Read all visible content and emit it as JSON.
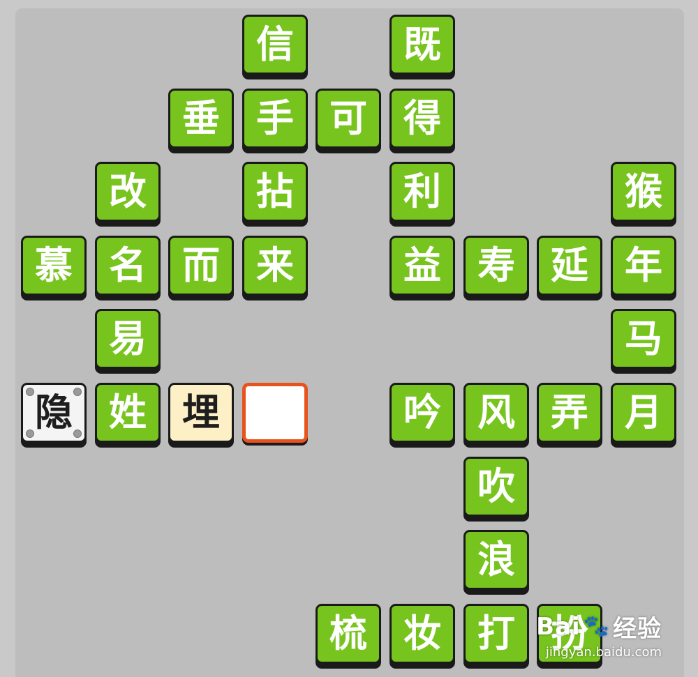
{
  "tiles": [
    {
      "ch": "信",
      "state": "green",
      "col": 3,
      "row": 0
    },
    {
      "ch": "既",
      "state": "green",
      "col": 5,
      "row": 0
    },
    {
      "ch": "垂",
      "state": "green",
      "col": 2,
      "row": 1
    },
    {
      "ch": "手",
      "state": "green",
      "col": 3,
      "row": 1
    },
    {
      "ch": "可",
      "state": "green",
      "col": 4,
      "row": 1
    },
    {
      "ch": "得",
      "state": "green",
      "col": 5,
      "row": 1
    },
    {
      "ch": "改",
      "state": "green",
      "col": 1,
      "row": 2
    },
    {
      "ch": "拈",
      "state": "green",
      "col": 3,
      "row": 2
    },
    {
      "ch": "利",
      "state": "green",
      "col": 5,
      "row": 2
    },
    {
      "ch": "猴",
      "state": "green",
      "col": 8,
      "row": 2
    },
    {
      "ch": "慕",
      "state": "green",
      "col": 0,
      "row": 3
    },
    {
      "ch": "名",
      "state": "green",
      "col": 1,
      "row": 3
    },
    {
      "ch": "而",
      "state": "green",
      "col": 2,
      "row": 3
    },
    {
      "ch": "来",
      "state": "green",
      "col": 3,
      "row": 3
    },
    {
      "ch": "益",
      "state": "green",
      "col": 5,
      "row": 3
    },
    {
      "ch": "寿",
      "state": "green",
      "col": 6,
      "row": 3
    },
    {
      "ch": "延",
      "state": "green",
      "col": 7,
      "row": 3
    },
    {
      "ch": "年",
      "state": "green",
      "col": 8,
      "row": 3
    },
    {
      "ch": "易",
      "state": "green",
      "col": 1,
      "row": 4
    },
    {
      "ch": "马",
      "state": "green",
      "col": 8,
      "row": 4
    },
    {
      "ch": "隐",
      "state": "given",
      "col": 0,
      "row": 5
    },
    {
      "ch": "姓",
      "state": "green",
      "col": 1,
      "row": 5
    },
    {
      "ch": "埋",
      "state": "filled",
      "col": 2,
      "row": 5
    },
    {
      "ch": "",
      "state": "blank",
      "col": 3,
      "row": 5
    },
    {
      "ch": "吟",
      "state": "green",
      "col": 5,
      "row": 5
    },
    {
      "ch": "风",
      "state": "green",
      "col": 6,
      "row": 5
    },
    {
      "ch": "弄",
      "state": "green",
      "col": 7,
      "row": 5
    },
    {
      "ch": "月",
      "state": "green",
      "col": 8,
      "row": 5
    },
    {
      "ch": "吹",
      "state": "green",
      "col": 6,
      "row": 6
    },
    {
      "ch": "浪",
      "state": "green",
      "col": 6,
      "row": 7
    },
    {
      "ch": "梳",
      "state": "green",
      "col": 4,
      "row": 8
    },
    {
      "ch": "妆",
      "state": "green",
      "col": 5,
      "row": 8
    },
    {
      "ch": "打",
      "state": "green",
      "col": 6,
      "row": 8
    },
    {
      "ch": "扮",
      "state": "green",
      "col": 7,
      "row": 8
    }
  ],
  "watermark": {
    "brand": "Bai",
    "brand2": "经验",
    "url": "jingyan.baidu.com"
  }
}
